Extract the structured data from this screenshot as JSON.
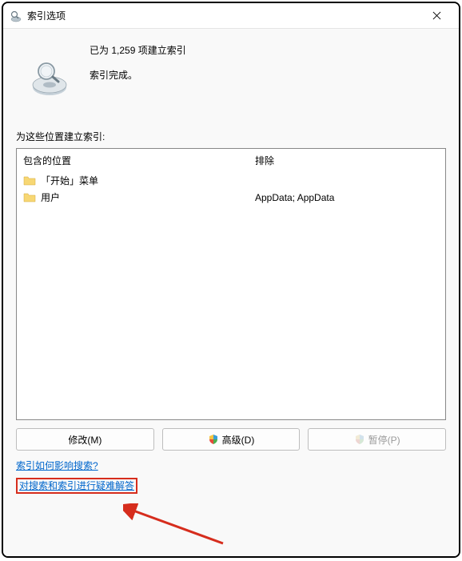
{
  "window": {
    "title": "索引选项"
  },
  "status": {
    "line1": "已为 1,259 项建立索引",
    "line2": "索引完成。"
  },
  "section_label": "为这些位置建立索引:",
  "locations": {
    "header_included": "包含的位置",
    "header_excluded": "排除",
    "rows": [
      {
        "label": "「开始」菜单",
        "exclude": ""
      },
      {
        "label": "用户",
        "exclude": "AppData; AppData"
      }
    ]
  },
  "buttons": {
    "modify": "修改(M)",
    "advanced": "高级(D)",
    "pause": "暂停(P)"
  },
  "links": {
    "how_affects": "索引如何影响搜索?",
    "troubleshoot": "对搜索和索引进行疑难解答"
  }
}
